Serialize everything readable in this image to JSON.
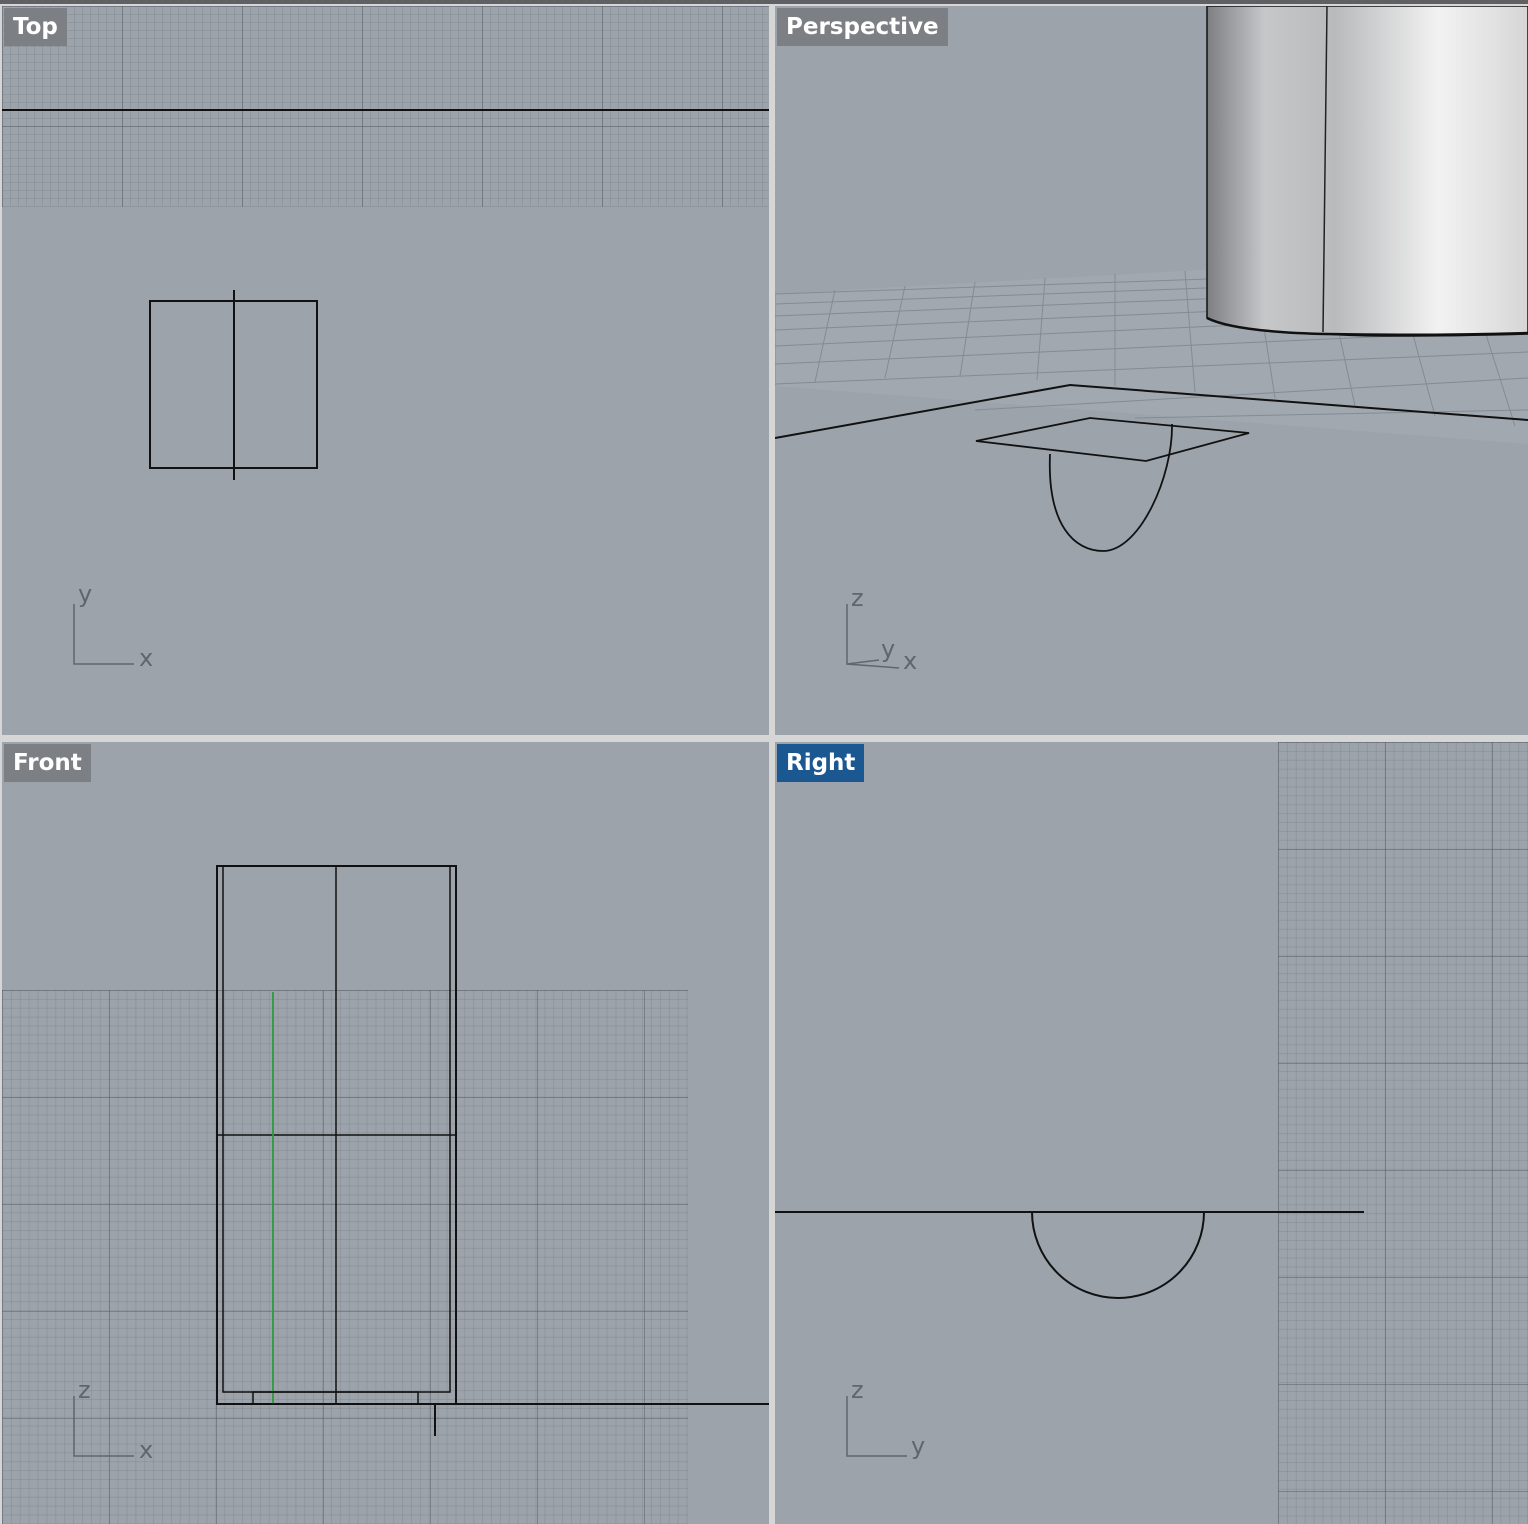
{
  "viewports": {
    "top": {
      "label": "Top",
      "axes": {
        "vertical": "y",
        "horizontal": "x"
      }
    },
    "perspective": {
      "label": "Perspective",
      "axes": {
        "vertical": "z",
        "depth": "y",
        "horizontal": "x"
      }
    },
    "front": {
      "label": "Front",
      "axes": {
        "vertical": "z",
        "horizontal": "x"
      }
    },
    "right": {
      "label": "Right",
      "axes": {
        "vertical": "z",
        "horizontal": "y"
      }
    }
  },
  "active_viewport": "Right",
  "colors": {
    "viewport_bg": "#9ca3ab",
    "inactive_label_bg": "#7c7f83",
    "active_label_bg": "#1b5892",
    "curve": "#111111",
    "selected_curve": "#2e9a3a",
    "axis_gizmo": "#5f666e"
  }
}
